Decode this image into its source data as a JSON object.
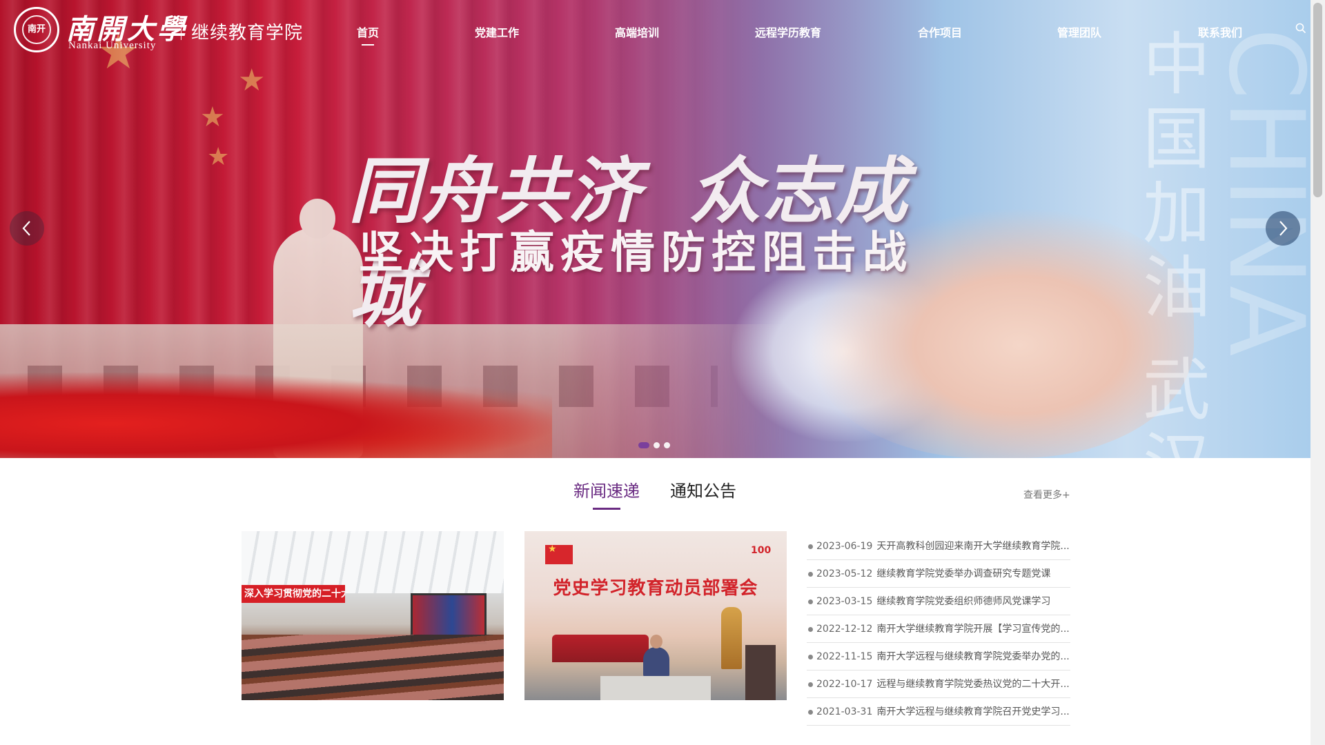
{
  "header": {
    "logo_seal_text": "南开",
    "logo_cn": "南開大學",
    "logo_en": "Nankai University",
    "college_name": "继续教育学院"
  },
  "nav": {
    "items": [
      {
        "label": "首页",
        "active": true
      },
      {
        "label": "党建工作"
      },
      {
        "label": "高端培训"
      },
      {
        "label": "远程学历教育"
      },
      {
        "label": "合作项目"
      },
      {
        "label": "管理团队"
      },
      {
        "label": "联系我们"
      }
    ],
    "search_icon": "search-icon"
  },
  "hero": {
    "slogan_part1": "同舟共济",
    "slogan_part2": "众志成城",
    "subslogan": "坚决打赢疫情防控阻击战",
    "watermark_cn": [
      "中",
      "国",
      "加",
      "油",
      "武",
      "汉"
    ],
    "watermark_en": "CHINA",
    "prev_icon": "chevron-left-icon",
    "next_icon": "chevron-right-icon",
    "slides": 3,
    "active_slide": 1
  },
  "news": {
    "tabs": [
      {
        "label": "新闻速递",
        "active": true
      },
      {
        "label": "通知公告"
      }
    ],
    "more_label": "查看更多+",
    "photo1_banner": "深入学习贯彻党的二十大精神",
    "photo2_title": "党史学习教育动员部署会",
    "photo2_badge": "100",
    "items": [
      {
        "date": "2023-06-19",
        "title": "天开高教科创园迎来南开大学继续教育学院..."
      },
      {
        "date": "2023-05-12",
        "title": "继续教育学院党委举办调查研究专题党课"
      },
      {
        "date": "2023-03-15",
        "title": "继续教育学院党委组织师德师风党课学习"
      },
      {
        "date": "2022-12-12",
        "title": "南开大学继续教育学院开展【学习宣传党的..."
      },
      {
        "date": "2022-11-15",
        "title": "南开大学远程与继续教育学院党委举办党的..."
      },
      {
        "date": "2022-10-17",
        "title": "远程与继续教育学院党委热议党的二十大开..."
      },
      {
        "date": "2021-03-31",
        "title": "南开大学远程与继续教育学院召开党史学习..."
      }
    ]
  },
  "colors": {
    "accent": "#6a2b82",
    "hero_red": "#c81d3a",
    "hero_blue": "#a9cdec"
  }
}
